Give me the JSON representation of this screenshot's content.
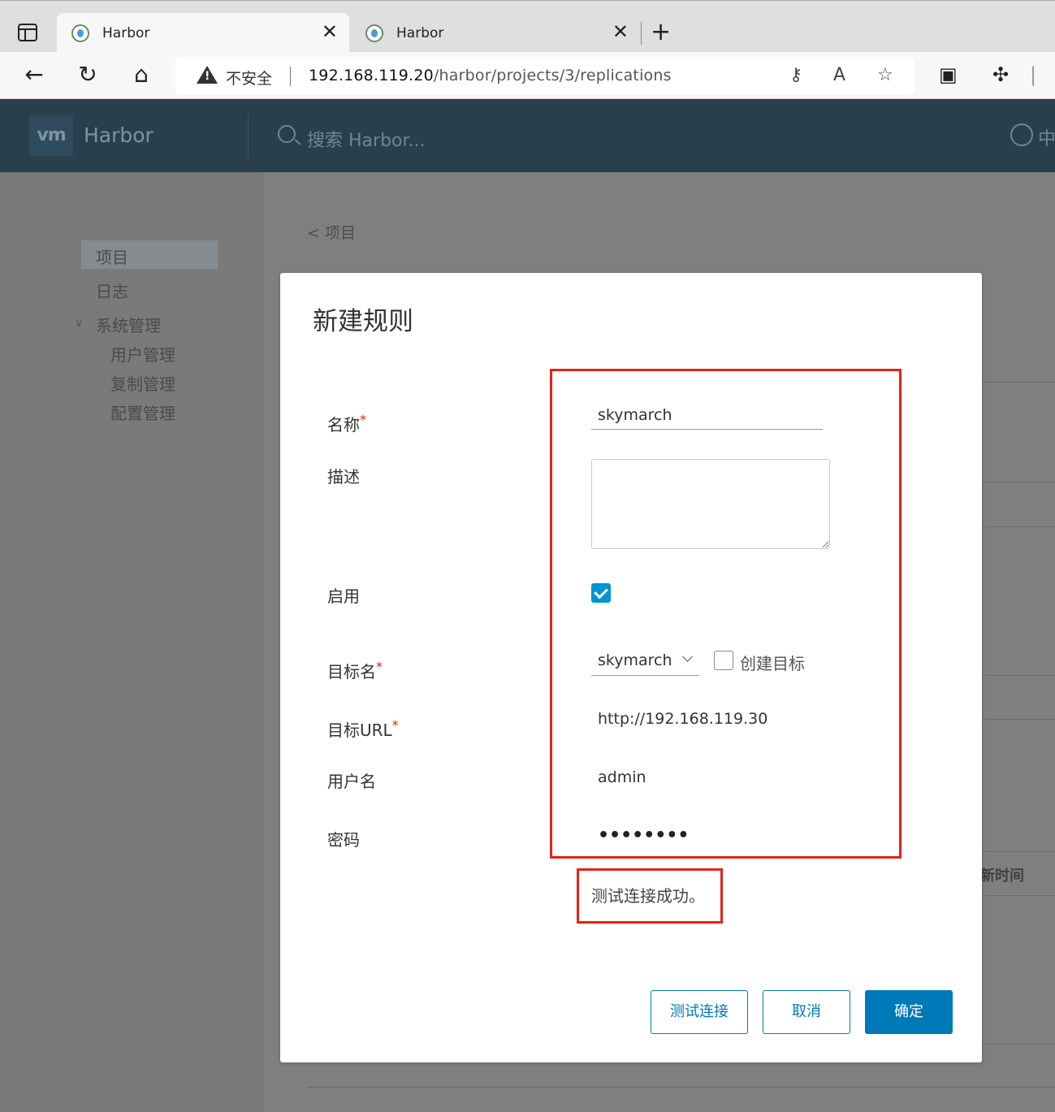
{
  "browser": {
    "tabs": [
      {
        "title": "Harbor",
        "active": true
      },
      {
        "title": "Harbor",
        "active": false
      }
    ],
    "address": {
      "security_label": "不安全",
      "url_host": "192.168.119.20",
      "url_path": "/harbor/projects/3/replications"
    }
  },
  "harbor": {
    "logo_text": "vm",
    "brand": "Harbor",
    "search_placeholder": "搜索 Harbor...",
    "lang": "中",
    "sidebar": {
      "items": [
        {
          "label": "项目"
        },
        {
          "label": "日志"
        },
        {
          "label": "系统管理"
        },
        {
          "label": "用户管理"
        },
        {
          "label": "复制管理"
        },
        {
          "label": "配置管理"
        }
      ]
    },
    "back_link": "< 项目",
    "bg_column_fragment": "新时间"
  },
  "modal": {
    "title": "新建规则",
    "labels": {
      "name": "名称",
      "description": "描述",
      "enable": "启用",
      "target_name": "目标名",
      "target_url": "目标URL",
      "username": "用户名",
      "password": "密码"
    },
    "required_mark": "*",
    "values": {
      "name": "skymarch",
      "description": "",
      "enabled": true,
      "target_name": "skymarch",
      "create_target_label": "创建目标",
      "create_target_checked": false,
      "target_url": "http://192.168.119.30",
      "username": "admin",
      "password_masked": "••••••••"
    },
    "status_message": "测试连接成功。",
    "buttons": {
      "test": "测试连接",
      "cancel": "取消",
      "ok": "确定"
    }
  },
  "colors": {
    "primary": "#0079b8",
    "checkbox": "#0094d2",
    "annotation": "#e8201a",
    "header": "#2a3f4e",
    "required": "#e12200"
  }
}
